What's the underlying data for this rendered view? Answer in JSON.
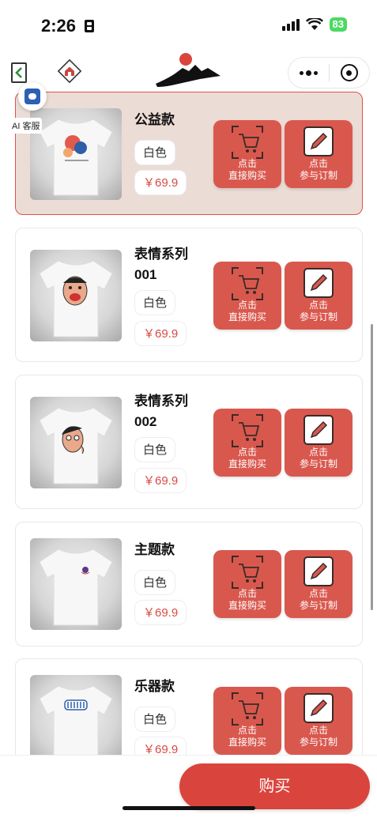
{
  "status_bar": {
    "time": "2:26",
    "battery": "83"
  },
  "nav": {
    "back_icon": "chevron-left-icon",
    "home_icon": "home-icon",
    "more_icon": "more-dots-icon",
    "close_icon": "target-close-icon"
  },
  "ai_service": {
    "label": "AI 客服"
  },
  "products": [
    {
      "name": "公益款",
      "color": "白色",
      "price": "￥69.9",
      "selected": true,
      "print": "family-illustration"
    },
    {
      "name": "表情系列001",
      "color": "白色",
      "price": "￥69.9",
      "selected": false,
      "print": "face-surprised"
    },
    {
      "name": "表情系列002",
      "color": "白色",
      "price": "￥69.9",
      "selected": false,
      "print": "face-thinking"
    },
    {
      "name": "主题款",
      "color": "白色",
      "price": "￥69.9",
      "selected": false,
      "print": "small-logo"
    },
    {
      "name": "乐器款",
      "color": "白色",
      "price": "￥69.9",
      "selected": false,
      "print": "instrument"
    }
  ],
  "buttons": {
    "buy_direct_line1": "点击",
    "buy_direct_line2": "直接购买",
    "customize_line1": "点击",
    "customize_line2": "参与订制",
    "buy_direct_icon": "shopping-cart-icon",
    "customize_icon": "pencil-edit-icon"
  },
  "bottom": {
    "buy_label": "购买"
  },
  "colors": {
    "accent": "#d9584e",
    "buy_button": "#d9453d",
    "selected_card": "#ecdcd6",
    "price": "#d94a44"
  }
}
